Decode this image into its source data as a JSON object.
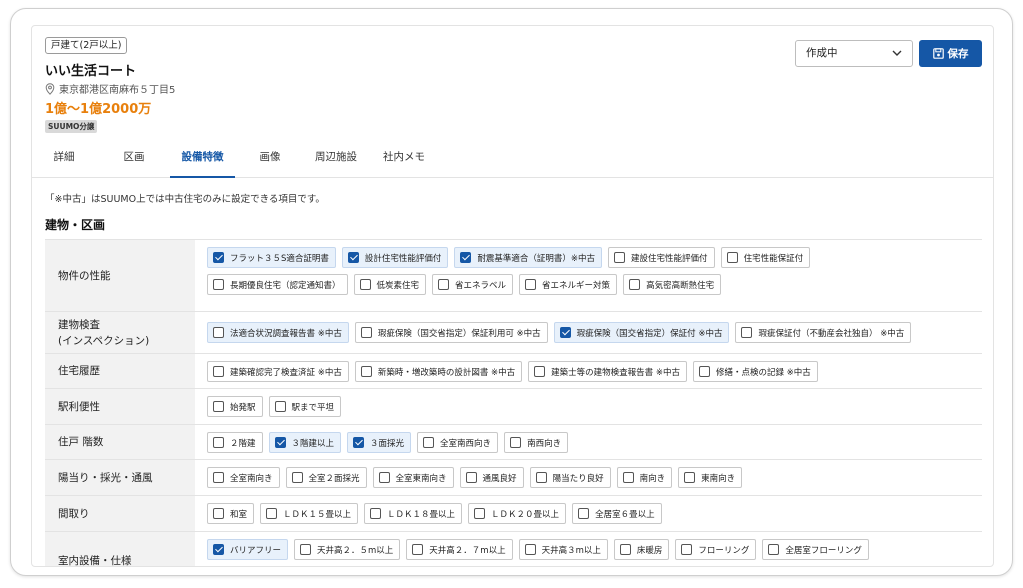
{
  "property": {
    "type_badge": "戸建て(2戸以上)",
    "name": "いい生活コート",
    "address": "東京都港区南麻布５丁目5",
    "price": "1億〜1億2000万",
    "suumo_badge": "SUUMO分譲"
  },
  "status": {
    "selected": "作成中"
  },
  "save_label": "保存",
  "tabs": [
    {
      "label": "詳細",
      "active": false
    },
    {
      "label": "区画",
      "active": false
    },
    {
      "label": "設備特徴",
      "active": true
    },
    {
      "label": "画像",
      "active": false
    },
    {
      "label": "周辺施設",
      "active": false
    },
    {
      "label": "社内メモ",
      "active": false
    }
  ],
  "note": "「※中古」はSUUMO上では中古住宅のみに設定できる項目です。",
  "section_title": "建物・区画",
  "rows": [
    {
      "label": "物件の性能",
      "options": [
        {
          "label": "フラット３５S適合証明書",
          "checked": true
        },
        {
          "label": "設計住宅性能評価付",
          "checked": true
        },
        {
          "label": "耐震基準適合（証明書）※中古",
          "checked": true
        },
        {
          "label": "建設住宅性能評価付",
          "checked": false
        },
        {
          "label": "住宅性能保証付",
          "checked": false
        },
        {
          "label": "長期優良住宅（認定通知書）",
          "checked": false
        },
        {
          "label": "低炭素住宅",
          "checked": false
        },
        {
          "label": "省エネラベル",
          "checked": false
        },
        {
          "label": "省エネルギー対策",
          "checked": false
        },
        {
          "label": "高気密高断熱住宅",
          "checked": false
        }
      ]
    },
    {
      "label": "建物検査\n(インスペクション)",
      "options": [
        {
          "label": "法適合状況調査報告書 ※中古",
          "checked": false,
          "highlight": true
        },
        {
          "label": "瑕疵保険（国交省指定）保証利用可 ※中古",
          "checked": false
        },
        {
          "label": "瑕疵保険（国交省指定）保証付 ※中古",
          "checked": true
        },
        {
          "label": "瑕疵保証付（不動産会社独自） ※中古",
          "checked": false
        }
      ]
    },
    {
      "label": "住宅履歴",
      "options": [
        {
          "label": "建築確認完了検査済証 ※中古",
          "checked": false
        },
        {
          "label": "新築時・増改築時の設計図書 ※中古",
          "checked": false
        },
        {
          "label": "建築士等の建物検査報告書 ※中古",
          "checked": false
        },
        {
          "label": "修繕・点検の記録 ※中古",
          "checked": false
        }
      ]
    },
    {
      "label": "駅利便性",
      "options": [
        {
          "label": "始発駅",
          "checked": false
        },
        {
          "label": "駅まで平坦",
          "checked": false
        }
      ]
    },
    {
      "label": "住戸 階数",
      "options": [
        {
          "label": "２階建",
          "checked": false
        },
        {
          "label": "３階建以上",
          "checked": true
        },
        {
          "label": "３面採光",
          "checked": true
        },
        {
          "label": "全室南西向き",
          "checked": false
        },
        {
          "label": "南西向き",
          "checked": false
        }
      ]
    },
    {
      "label": "陽当り・採光・通風",
      "options": [
        {
          "label": "全室南向き",
          "checked": false
        },
        {
          "label": "全室２面採光",
          "checked": false
        },
        {
          "label": "全室東南向き",
          "checked": false
        },
        {
          "label": "通風良好",
          "checked": false
        },
        {
          "label": "陽当たり良好",
          "checked": false
        },
        {
          "label": "南向き",
          "checked": false
        },
        {
          "label": "東南向き",
          "checked": false
        }
      ]
    },
    {
      "label": "間取り",
      "options": [
        {
          "label": "和室",
          "checked": false
        },
        {
          "label": "ＬＤＫ１５畳以上",
          "checked": false
        },
        {
          "label": "ＬＤＫ１８畳以上",
          "checked": false
        },
        {
          "label": "ＬＤＫ２０畳以上",
          "checked": false
        },
        {
          "label": "全居室６畳以上",
          "checked": false
        }
      ]
    },
    {
      "label": "室内設備・仕様",
      "options": [
        {
          "label": "バリアフリー",
          "checked": true
        },
        {
          "label": "天井高２．５m以上",
          "checked": false
        },
        {
          "label": "天井高２．７m以上",
          "checked": false
        },
        {
          "label": "天井高３m以上",
          "checked": false
        },
        {
          "label": "床暖房",
          "checked": false
        },
        {
          "label": "フローリング",
          "checked": false
        },
        {
          "label": "全居室フローリング",
          "checked": false
        }
      ]
    }
  ]
}
